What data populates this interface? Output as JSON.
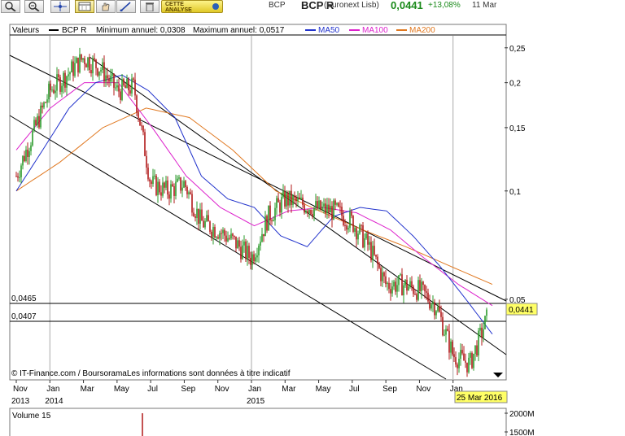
{
  "toolbar": {
    "buttons": [
      "zoom-in",
      "zoom-out",
      "crosshair",
      "period-select",
      "hand-pan",
      "zoom-area",
      "compare",
      "delete"
    ],
    "analysis_label_1": "CETTE",
    "analysis_label_2": "ANALYSE"
  },
  "quote": {
    "symbol": "BCP",
    "symbol_bold": "BCP R",
    "exchange": "(Euronext Lisb)",
    "price": "0,0441",
    "change": "+13,08%",
    "date": "11 Mar"
  },
  "legend": {
    "label": "Valeurs",
    "series_name": "BCP R",
    "min_text": "Minimum annuel: 0,0308",
    "max_text": "Maximum annuel: 0,0517",
    "ma50": "MA50",
    "ma100": "MA100",
    "ma200": "MA200"
  },
  "colors": {
    "candle_up": "#2a9a2a",
    "candle_down": "#b01818",
    "ma50": "#2233cc",
    "ma100": "#dd22cc",
    "ma200": "#e07820",
    "channel": "#000000",
    "cursor_label_bg": "#ffff66"
  },
  "levels": {
    "line1": "0,0465",
    "line2": "0,0407",
    "last_price": "0,0441"
  },
  "source_text": "© IT-Finance.com / BoursoramaLes informations sont données à titre indicatif",
  "cursor_date": "25 Mar 2016",
  "volume": {
    "label": "Volume 15",
    "ticks": [
      "2000M",
      "1500M"
    ]
  },
  "chart_data": {
    "type": "candlestick",
    "y_scale": "log",
    "ylim": [
      0.03,
      0.27
    ],
    "y_ticks": [
      "0,25",
      "0,2",
      "0,15",
      "0,1",
      "0,05"
    ],
    "x_ticks": [
      "Nov",
      "Jan",
      "Mar",
      "May",
      "Jul",
      "Sep",
      "Nov",
      "Jan",
      "Mar",
      "May",
      "Jul",
      "Sep",
      "Nov",
      "Jan"
    ],
    "year_labels": [
      "2013",
      "2014",
      "2015"
    ],
    "close_path": [
      [
        "2013-11",
        0.11
      ],
      [
        "2013-12",
        0.145
      ],
      [
        "2014-01",
        0.19
      ],
      [
        "2014-02",
        0.21
      ],
      [
        "2014-03",
        0.235
      ],
      [
        "2014-04",
        0.22
      ],
      [
        "2014-05",
        0.19
      ],
      [
        "2014-06",
        0.195
      ],
      [
        "2014-07",
        0.105
      ],
      [
        "2014-08",
        0.1
      ],
      [
        "2014-09",
        0.105
      ],
      [
        "2014-10",
        0.082
      ],
      [
        "2014-11",
        0.078
      ],
      [
        "2014-12",
        0.072
      ],
      [
        "2015-01",
        0.065
      ],
      [
        "2015-02",
        0.085
      ],
      [
        "2015-03",
        0.095
      ],
      [
        "2015-04",
        0.092
      ],
      [
        "2015-05",
        0.089
      ],
      [
        "2015-06",
        0.088
      ],
      [
        "2015-07",
        0.082
      ],
      [
        "2015-08",
        0.07
      ],
      [
        "2015-09",
        0.055
      ],
      [
        "2015-10",
        0.055
      ],
      [
        "2015-11",
        0.053
      ],
      [
        "2015-12",
        0.048
      ],
      [
        "2016-01",
        0.035
      ],
      [
        "2016-02",
        0.033
      ],
      [
        "2016-03",
        0.0441
      ]
    ],
    "ma50": [
      0.1,
      0.13,
      0.17,
      0.2,
      0.21,
      0.19,
      0.16,
      0.11,
      0.095,
      0.09,
      0.075,
      0.07,
      0.085,
      0.09,
      0.088,
      0.075,
      0.062,
      0.05,
      0.04
    ],
    "ma100": [
      0.13,
      0.17,
      0.2,
      0.2,
      0.15,
      0.11,
      0.09,
      0.08,
      0.088,
      0.09,
      0.087,
      0.078,
      0.065,
      0.055,
      0.048
    ],
    "ma200": [
      0.1,
      0.12,
      0.15,
      0.17,
      0.16,
      0.13,
      0.1,
      0.088,
      0.078,
      0.07,
      0.062,
      0.055
    ]
  }
}
